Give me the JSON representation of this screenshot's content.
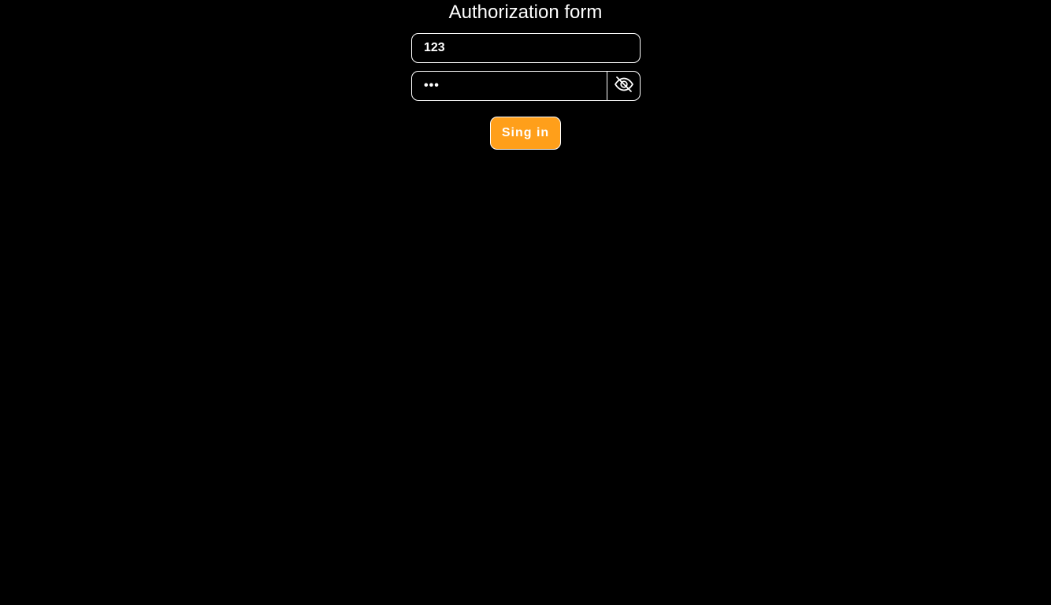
{
  "form": {
    "title": "Authorization form",
    "login_value": "123",
    "password_value": "•••",
    "password_toggle_icon": "eye-slash-icon",
    "submit_label": "Sing in"
  },
  "colors": {
    "background": "#000000",
    "text": "#ffffff",
    "border": "#ffffff",
    "accent": "#ff9f1a"
  }
}
